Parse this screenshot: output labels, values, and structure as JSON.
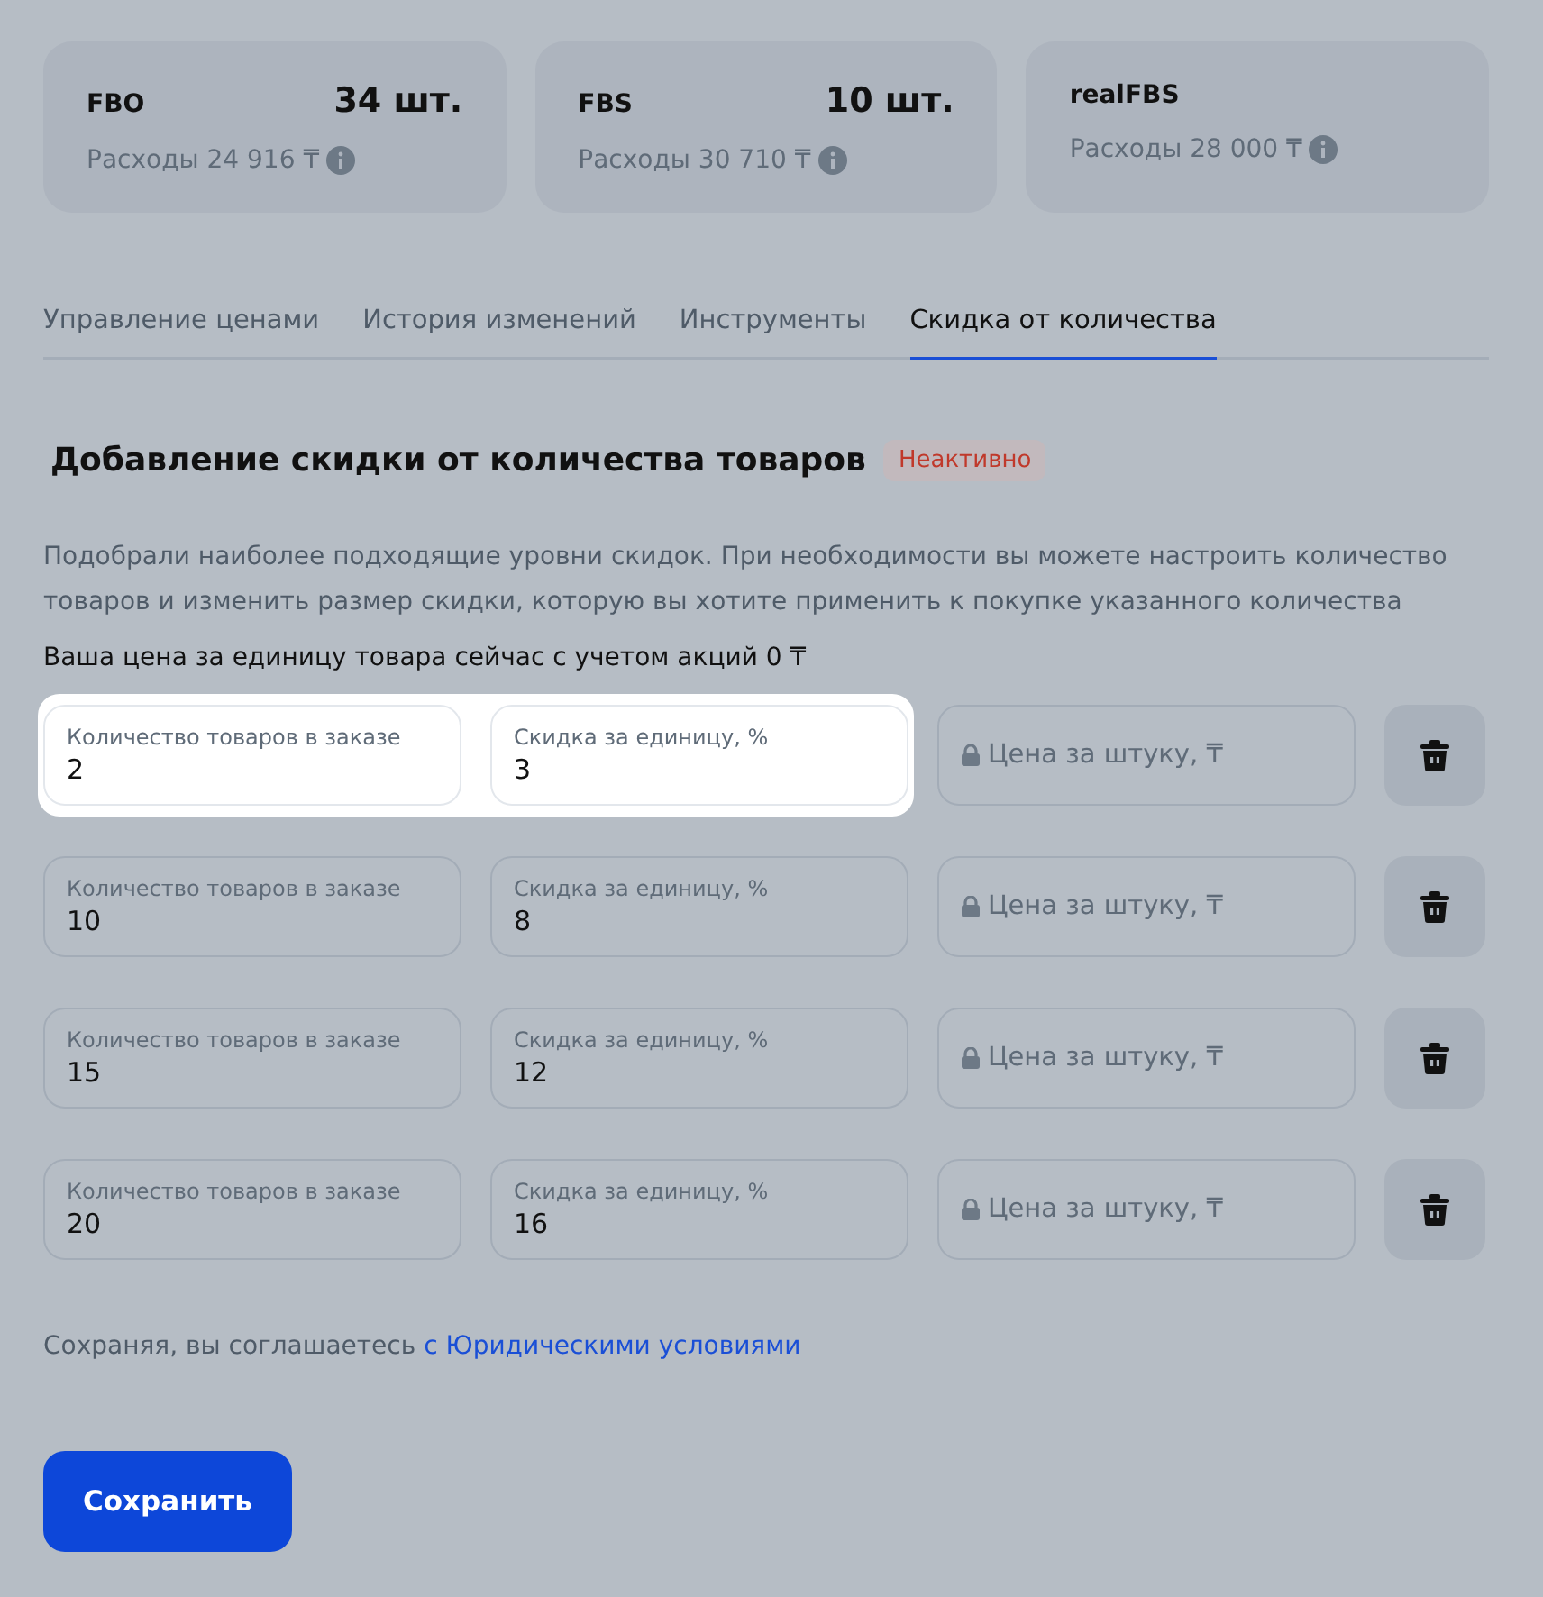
{
  "stock_cards": [
    {
      "title": "FBO",
      "count": "34 шт.",
      "expenses": "Расходы 24 916 ₸"
    },
    {
      "title": "FBS",
      "count": "10 шт.",
      "expenses": "Расходы 30 710 ₸"
    },
    {
      "title": "realFBS",
      "expenses": "Расходы 28 000 ₸"
    }
  ],
  "tabs": [
    {
      "label": "Управление ценами",
      "selected": false
    },
    {
      "label": "История изменений",
      "selected": false
    },
    {
      "label": "Инструменты",
      "selected": false
    },
    {
      "label": "Скидка от количества",
      "selected": true
    }
  ],
  "section": {
    "title": "Добавление скидки от количества товаров",
    "status": "Неактивно",
    "description": "Подобрали наиболее подходящие уровни скидок. При необходимости вы можете настроить количество товаров и изменить размер скидки, которую вы хотите применить к покупке указанного количества",
    "current_price": "Ваша цена за единицу товара сейчас с учетом акций 0 ₸"
  },
  "tiers": [
    {
      "quantity_label": "Количество товаров в заказе",
      "quantity": "2",
      "discount_label": "Скидка за единицу, %",
      "discount": "3",
      "price_placeholder": "Цена за штуку, ₸",
      "highlighted": true
    },
    {
      "quantity_label": "Количество товаров в заказе",
      "quantity": "10",
      "discount_label": "Скидка за единицу, %",
      "discount": "8",
      "price_placeholder": "Цена за штуку, ₸",
      "highlighted": false
    },
    {
      "quantity_label": "Количество товаров в заказе",
      "quantity": "15",
      "discount_label": "Скидка за единицу, %",
      "discount": "12",
      "price_placeholder": "Цена за штуку, ₸",
      "highlighted": false
    },
    {
      "quantity_label": "Количество товаров в заказе",
      "quantity": "20",
      "discount_label": "Скидка за единицу, %",
      "discount": "16",
      "price_placeholder": "Цена за штуку, ₸",
      "highlighted": false
    }
  ],
  "legal": {
    "text": "Сохраняя, вы соглашаетесь",
    "link": "с Юридическими условиями"
  },
  "save_button": "Сохранить"
}
